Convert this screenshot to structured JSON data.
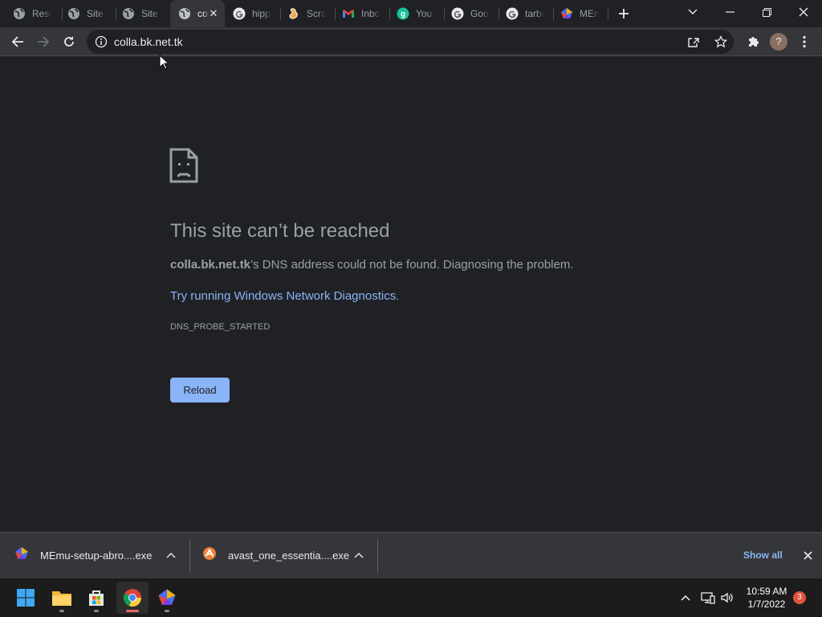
{
  "tabs": [
    {
      "title": "Resume",
      "icon": "globe-icon"
    },
    {
      "title": "Site Explorer",
      "icon": "globe-icon"
    },
    {
      "title": "Site Explorer",
      "icon": "globe-icon"
    },
    {
      "title": "colla.bk.net.tk",
      "icon": "globe-icon",
      "active": true
    },
    {
      "title": "hippo",
      "icon": "google-icon"
    },
    {
      "title": "Scratch",
      "icon": "scratch-icon"
    },
    {
      "title": "Inbox",
      "icon": "gmail-icon"
    },
    {
      "title": "You A",
      "icon": "grammarly-icon"
    },
    {
      "title": "Google",
      "icon": "google-icon"
    },
    {
      "title": "tarba",
      "icon": "google-icon"
    },
    {
      "title": "MEmu",
      "icon": "memu-icon"
    }
  ],
  "toolbar": {
    "url": "colla.bk.net.tk",
    "profile_initial": "?"
  },
  "error_page": {
    "title": "This site can’t be reached",
    "host": "colla.bk.net.tk",
    "desc_rest": "’s DNS address could not be found. Diagnosing the problem.",
    "link_text": "Try running Windows Network Diagnostics",
    "link_period": ".",
    "error_code": "DNS_PROBE_STARTED",
    "reload_label": "Reload"
  },
  "downloads": {
    "items": [
      {
        "name": "MEmu-setup-abro....exe",
        "icon": "memu-icon"
      },
      {
        "name": "avast_one_essentia....exe",
        "icon": "avast-icon"
      }
    ],
    "show_all_label": "Show all"
  },
  "taskbar": {
    "apps": [
      "windows-start-icon",
      "file-explorer-icon",
      "microsoft-store-icon",
      "chrome-icon",
      "memu-icon"
    ],
    "time": "10:59 AM",
    "date": "1/7/2022",
    "notification_count": "3"
  },
  "colors": {
    "background": "#202124",
    "toolbar": "#35363a",
    "accent_link": "#8ab4f8",
    "button": "#8ab4f8",
    "notification_badge": "#e0543c"
  }
}
